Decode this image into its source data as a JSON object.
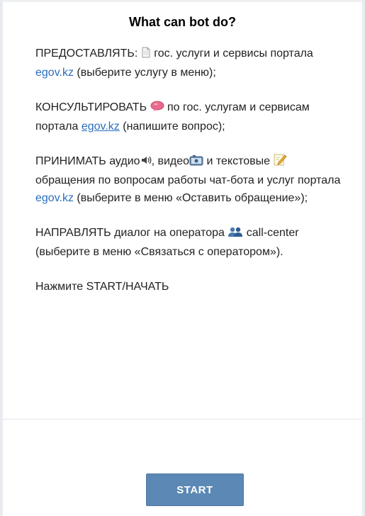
{
  "title": "What can bot do?",
  "paragraphs": {
    "p1": {
      "a": "ПРЕДОСТАВЛЯТЬ: ",
      "b": " гос. услуги и сервисы портала ",
      "link": "egov.kz",
      "c": " (выберите услугу в меню);"
    },
    "p2": {
      "a": "КОНСУЛЬТИРОВАТЬ ",
      "b": " по гос. услугам и сервисам портала ",
      "link": "egov.kz",
      "c": " (напишите вопрос);"
    },
    "p3": {
      "a": "ПРИНИМАТЬ аудио",
      "b": ", видео",
      "c": " и текстовые ",
      "d": " обращения по вопросам работы чат-бота и услуг портала ",
      "link": "egov.kz",
      "e": " (выберите в меню «Оставить обращение»);"
    },
    "p4": {
      "a": "НАПРАВЛЯТЬ диалог на оператора ",
      "b": " call-center (выберите в меню «Связаться с оператором»)."
    },
    "p5": "Нажмите START/НАЧАТЬ"
  },
  "start_label": "START",
  "colors": {
    "link": "#2a6ebd",
    "button_bg": "#5b88b5"
  },
  "icons": [
    "document-icon",
    "speech-bubble-icon",
    "speaker-icon",
    "video-icon",
    "pencil-note-icon",
    "people-icon"
  ]
}
